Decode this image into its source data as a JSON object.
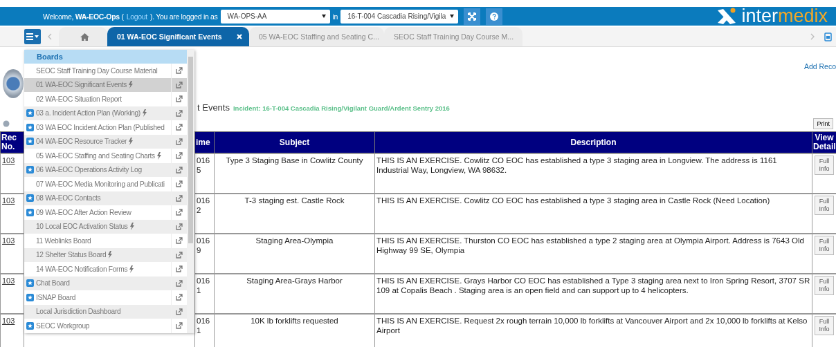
{
  "top_bar": {
    "greeting": "Welcome, **WA-EOC-Ops** (",
    "logout_link": "Logout",
    "greeting_tail": "). You are logged in as",
    "role_select": "WA-OPS-AA",
    "in_label": "in",
    "incident_select": "16-T-004 Cascadia Rising/Vigila",
    "logo": {
      "first": "inter",
      "second": "medix"
    }
  },
  "tabs": [
    {
      "kind": "home",
      "selected": false
    },
    {
      "kind": "board",
      "label": "01 WA-EOC Significant Events",
      "selected": true
    },
    {
      "kind": "board",
      "label": "05 WA-EOC Staffing and Seating C...",
      "selected": false
    },
    {
      "kind": "board",
      "label": "SEOC Staff Training Day Course M...",
      "selected": false
    }
  ],
  "page": {
    "add_link": "Add Reco",
    "title": "t Events",
    "incident": "Incident: 16-T-004 Cascadia Rising/Vigilant Guard/Ardent Sentry 2016",
    "print_button": "Print"
  },
  "table": {
    "columns": [
      "Rec No.",
      "ime",
      "Subject",
      "Description",
      "View Detail"
    ],
    "rows": [
      {
        "rec": "103",
        "time": "016\n5",
        "subject": "Type 3 Staging Base in Cowlitz County",
        "description": "THIS IS AN EXERCISE. Cowlitz CO EOC has established a type 3 staging area in Longview. The address is 1161 Industrial Way, Longview, WA 98632.",
        "action": "Full Info"
      },
      {
        "rec": "103",
        "time": "016\n2",
        "subject": "T-3 staging est. Castle Rock",
        "description": "THIS IS AN EXERCISE. Cowlitz CO EOC has established a type 3 staging area in Castle Rock (Need Location)",
        "action": "Full Info"
      },
      {
        "rec": "103",
        "time": "016\n9",
        "subject": "Staging Area-Olympia",
        "description": "THIS IS AN EXERCISE. Thurston CO EOC has established a type 2 staging area at Olympia Airport. Address is 7643 Old Highway 99 SE, Olympia",
        "action": "Full Info"
      },
      {
        "rec": "103",
        "time": "016\n1",
        "subject": "Staging Area-Grays Harbor",
        "description": "THIS IS AN EXERCISE. Grays Harbor CO EOC has established a Type 3 staging area next to Iron Spring Resort, 3707 SR 109 at Copalis Beach . Staging area is an open field and can support up to 4 helicopters.",
        "action": "Full Info"
      },
      {
        "rec": "103",
        "time": "016\n1",
        "subject": "10K lb forklifts requested",
        "description": "THIS IS AN EXERCISE. Request 2x rough terrain 10,000 lb forklifts at Vancouver Airport and 2x 10,000 lb forklifts at Kelso Airport",
        "action": "Full Info"
      }
    ]
  },
  "boards_menu": {
    "header": "Boards",
    "items": [
      {
        "label": "SEOC Staff Training Day Course Material",
        "starred": false,
        "live": false,
        "selected": false
      },
      {
        "label": "01 WA-EOC Significant Events",
        "starred": false,
        "live": true,
        "selected": true
      },
      {
        "label": "02 WA-EOC Situation Report",
        "starred": false,
        "live": false,
        "selected": false
      },
      {
        "label": "03 a. Incident Action Plan (Working)",
        "starred": true,
        "live": true,
        "selected": false
      },
      {
        "label": "03 WA EOC Incident Action Plan (Published",
        "starred": true,
        "live": false,
        "selected": false
      },
      {
        "label": "04 WA-EOC Resource Tracker",
        "starred": true,
        "live": true,
        "selected": false
      },
      {
        "label": "05 WA-EOC Staffing and Seating Charts",
        "starred": false,
        "live": true,
        "selected": false
      },
      {
        "label": "06 WA-EOC Operations Activity Log",
        "starred": true,
        "live": false,
        "selected": false
      },
      {
        "label": "07 WA-EOC Media Monitoring and Publicati",
        "starred": false,
        "live": false,
        "selected": false
      },
      {
        "label": "08 WA-EOC Contacts",
        "starred": true,
        "live": false,
        "selected": false
      },
      {
        "label": "09 WA-EOC After Action Review",
        "starred": true,
        "live": false,
        "selected": false
      },
      {
        "label": "10 Local EOC Activation Status",
        "starred": false,
        "live": true,
        "selected": false
      },
      {
        "label": "11 Weblinks Board",
        "starred": false,
        "live": false,
        "selected": false
      },
      {
        "label": "12 Shelter Status Board",
        "starred": false,
        "live": true,
        "selected": false
      },
      {
        "label": "14 WA-EOC Notification Forms",
        "starred": false,
        "live": true,
        "selected": false
      },
      {
        "label": "Chat Board",
        "starred": true,
        "live": false,
        "selected": false
      },
      {
        "label": "ISNAP Board",
        "starred": true,
        "live": false,
        "selected": false
      },
      {
        "label": "Local Jurisdiction Dashboard",
        "starred": false,
        "live": false,
        "selected": false
      },
      {
        "label": "SEOC Workgroup",
        "starred": true,
        "live": false,
        "selected": false
      }
    ]
  }
}
